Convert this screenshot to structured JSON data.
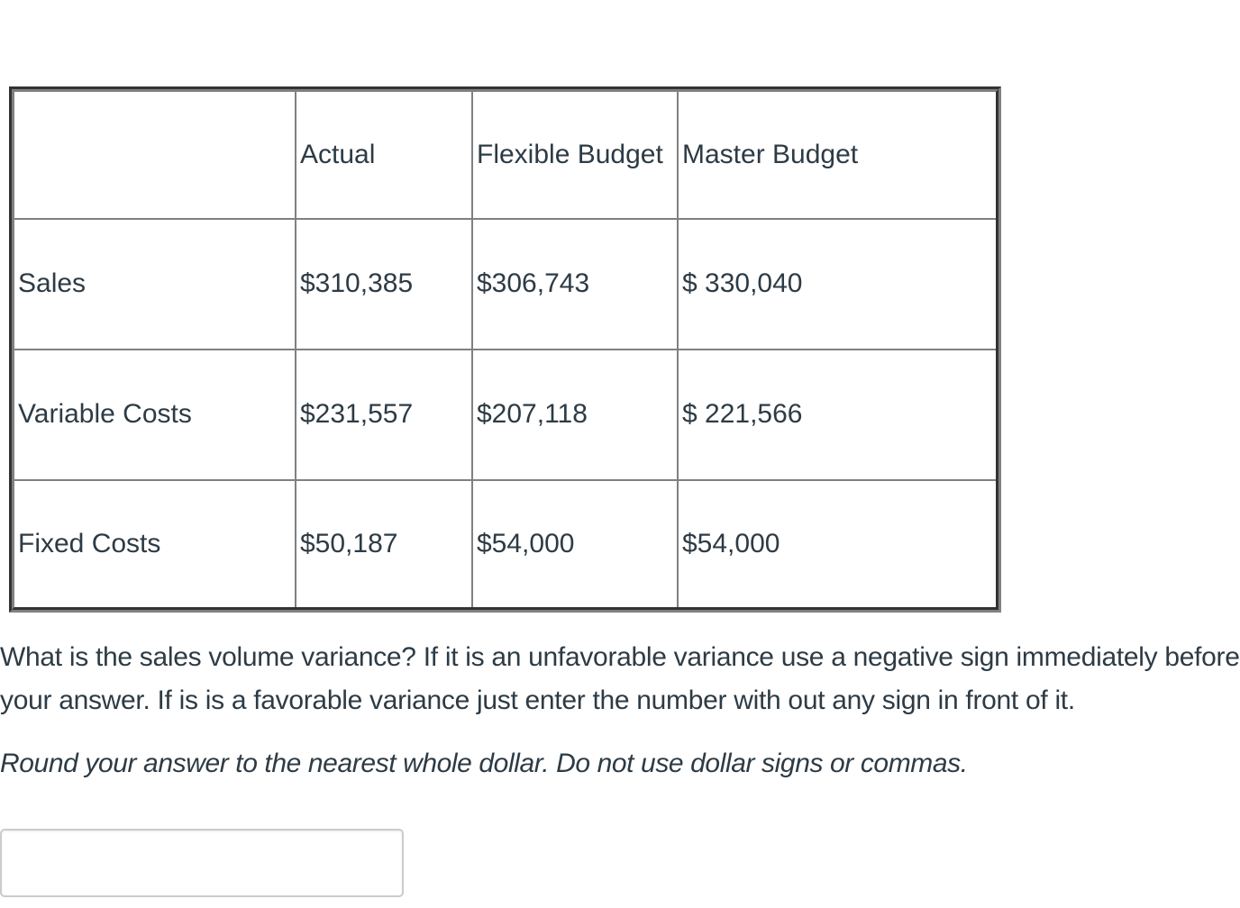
{
  "table": {
    "headers": [
      "",
      "Actual",
      "Flexible Budget",
      "Master Budget"
    ],
    "rows": [
      {
        "label": "Sales",
        "actual": "$310,385",
        "flexible_budget": "$306,743",
        "master_budget": "$ 330,040"
      },
      {
        "label": "Variable Costs",
        "actual": "$231,557",
        "flexible_budget": "$207,118",
        "master_budget": "$ 221,566"
      },
      {
        "label": "Fixed Costs",
        "actual": "$50,187",
        "flexible_budget": "$54,000",
        "master_budget": "$54,000"
      }
    ]
  },
  "question": {
    "text": "What is the sales volume variance?  If it is an unfavorable variance use a negative sign immediately before your answer.  If is is a favorable variance just enter the number with out any sign in front of it.",
    "instruction": "Round your answer to the nearest whole dollar. Do not use dollar signs or commas."
  },
  "answer": {
    "value": "",
    "placeholder": ""
  },
  "colors": {
    "text": "#2d3b45",
    "table_border_dark": "#333333",
    "table_border_gray": "#808080",
    "input_border": "#cccccc"
  }
}
